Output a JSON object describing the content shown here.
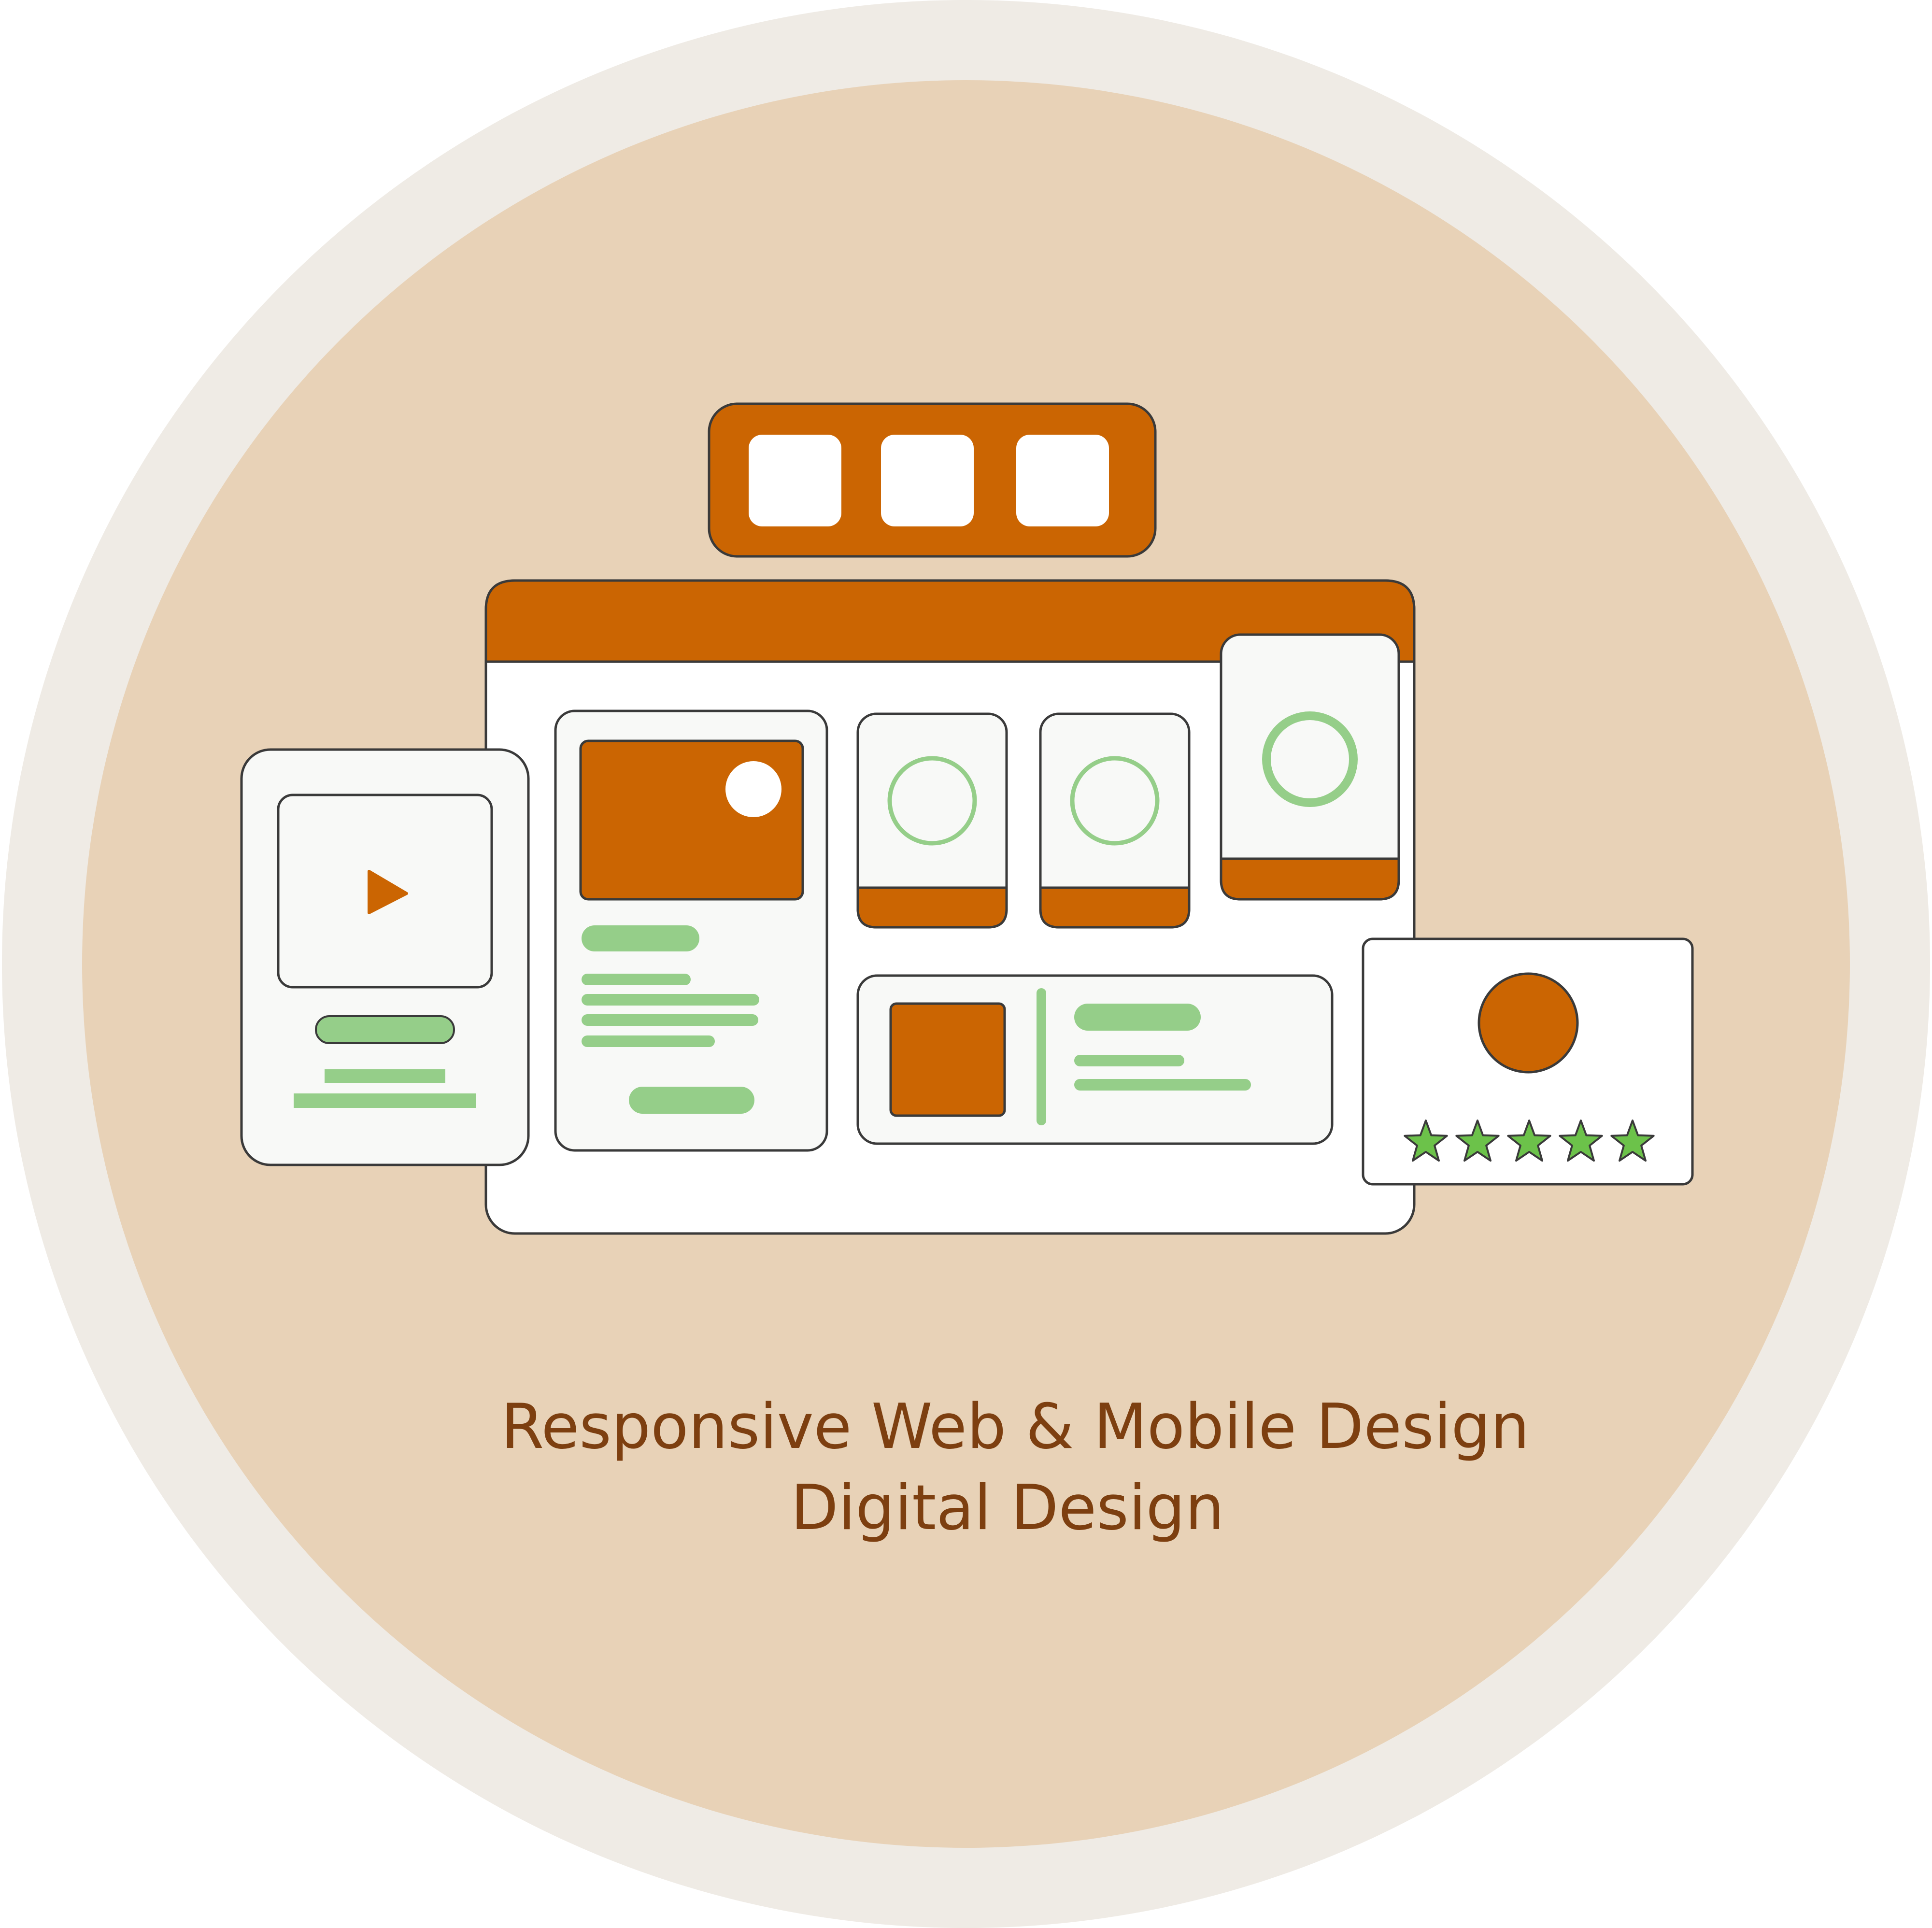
{
  "caption": {
    "line1": "Responsive Web & Mobile Design",
    "line2": "Digital Design"
  },
  "illustration": {
    "toolbar_squares": 3,
    "rating_stars": 5
  },
  "colors": {
    "outer_ring": "#efebe5",
    "badge_fill": "#e8d2b7",
    "accent": "#cb6502",
    "green": "#95ce89",
    "star_green": "#6cc24a",
    "card_fill": "#f8f9f7",
    "window_fill": "#ffffff",
    "outline": "#3a3a3a",
    "caption_text": "#7d3f10"
  }
}
